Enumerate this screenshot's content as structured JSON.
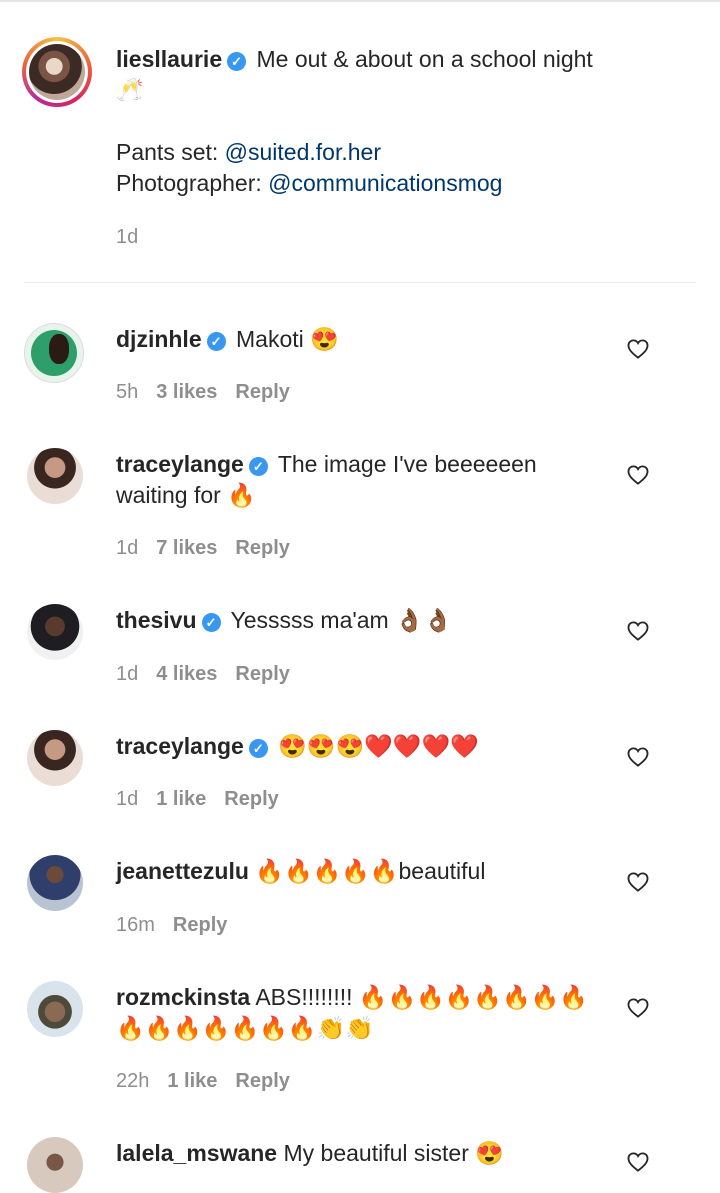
{
  "caption": {
    "username": "liesllaurie",
    "text_line1": "Me out & about on a school night",
    "emoji_line": "🥂",
    "pants_label": "Pants set: ",
    "pants_link": "@suited.for.her",
    "photographer_label": "Photographer: ",
    "photographer_link": "@communicationsmog",
    "time": "1d"
  },
  "comments": [
    {
      "username": "djzinhle",
      "verified": true,
      "text": "Makoti 😍",
      "time": "5h",
      "likes": "3 likes",
      "reply": "Reply"
    },
    {
      "username": "traceylange",
      "verified": true,
      "text": "The image I've beeeeeen",
      "text2": "waiting for 🔥",
      "time": "1d",
      "likes": "7 likes",
      "reply": "Reply"
    },
    {
      "username": "thesivu",
      "verified": true,
      "text": "Yesssss ma'am 👌🏾👌🏾",
      "time": "1d",
      "likes": "4 likes",
      "reply": "Reply"
    },
    {
      "username": "traceylange",
      "verified": true,
      "text": "😍😍😍❤️❤️❤️❤️",
      "time": "1d",
      "likes": "1 like",
      "reply": "Reply"
    },
    {
      "username": "jeanettezulu",
      "verified": false,
      "text": "🔥🔥🔥🔥🔥beautiful",
      "time": "16m",
      "reply": "Reply"
    },
    {
      "username": "rozmckinsta",
      "verified": false,
      "text": "ABS!!!!!!!! 🔥🔥🔥🔥🔥🔥🔥🔥",
      "text2": "🔥🔥🔥🔥🔥🔥🔥👏👏",
      "time": "22h",
      "likes": "1 like",
      "reply": "Reply"
    },
    {
      "username": "lalela_mswane",
      "verified": false,
      "text": "My beautiful sister 😍"
    }
  ],
  "icons": {
    "verified": "✓",
    "heart": "heart-outline-icon"
  },
  "colors": {
    "verified": "#3897f0",
    "link": "#00376b",
    "meta": "#8e8e8e"
  }
}
